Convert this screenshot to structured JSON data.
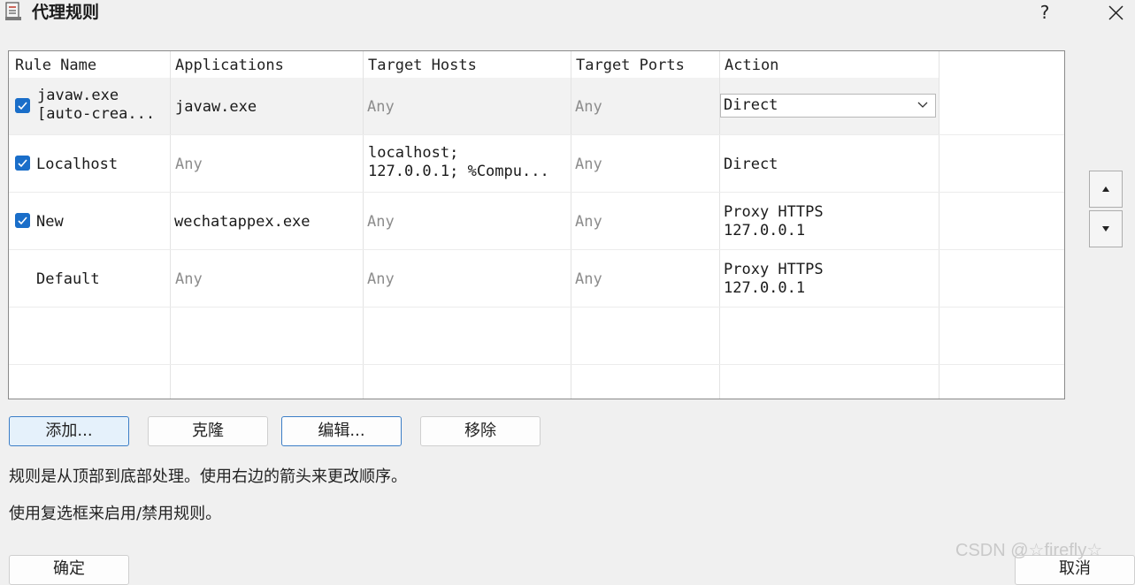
{
  "window": {
    "title": "代理规则",
    "help_label": "?"
  },
  "table": {
    "columns": [
      "Rule Name",
      "Applications",
      "Target Hosts",
      "Target Ports",
      "Action"
    ],
    "rows": [
      {
        "checked": true,
        "name_line1": "javaw.exe",
        "name_line2": "[auto-crea...",
        "applications": "javaw.exe",
        "hosts_line1": "Any",
        "hosts_line2": "",
        "ports": "Any",
        "action_line1": "Direct",
        "action_line2": ""
      },
      {
        "checked": true,
        "name_line1": "Localhost",
        "name_line2": "",
        "applications": "Any",
        "hosts_line1": "localhost;",
        "hosts_line2": "127.0.0.1; %Compu...",
        "ports": "Any",
        "action_line1": "Direct",
        "action_line2": ""
      },
      {
        "checked": true,
        "name_line1": "New",
        "name_line2": "",
        "applications": "wechatappex.exe",
        "hosts_line1": "Any",
        "hosts_line2": "",
        "ports": "Any",
        "action_line1": "Proxy HTTPS",
        "action_line2": "127.0.0.1"
      },
      {
        "checked": false,
        "name_line1": "Default",
        "name_line2": "",
        "applications": "Any",
        "hosts_line1": "Any",
        "hosts_line2": "",
        "ports": "Any",
        "action_line1": "Proxy HTTPS",
        "action_line2": "127.0.0.1"
      }
    ],
    "action_dropdown_value": "Direct"
  },
  "buttons": {
    "add": "添加...",
    "clone": "克隆",
    "edit": "编辑...",
    "remove": "移除",
    "ok": "确定",
    "cancel": "取消"
  },
  "info": {
    "line1": "规则是从顶部到底部处理。使用右边的箭头来更改顺序。",
    "line2": "使用复选框来启用/禁用规则。"
  },
  "watermark": "CSDN @☆firefly☆",
  "colors": {
    "checkbox": "#1a6ec9",
    "focus_border": "#3c7ec7",
    "focus_fill": "#e5f1fb"
  },
  "icons": {
    "app": "document-list-icon",
    "move_up": "triangle-up-icon",
    "move_down": "triangle-down-icon",
    "close": "close-icon",
    "dropdown": "chevron-down-icon"
  }
}
